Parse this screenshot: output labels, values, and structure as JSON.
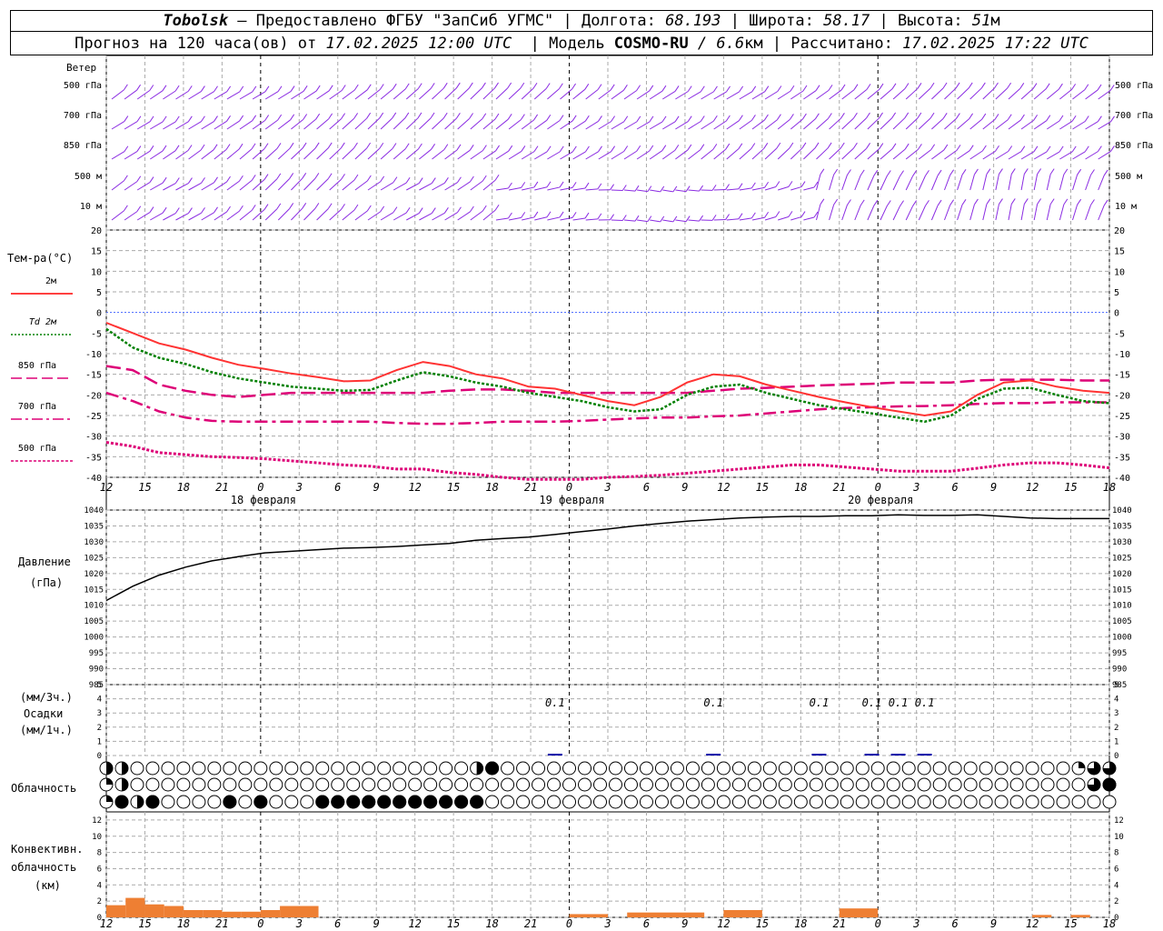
{
  "header": {
    "station": "Tobolsk",
    "provider": " — Предоставлено ФГБУ \"ЗапСиб УГМС\" | Долгота: ",
    "lon": "68.193",
    "lat_label": " | Широта: ",
    "lat": "58.17",
    "alt_label": " | Высота: ",
    "alt": "51",
    "alt_unit": "м",
    "forecast_label": "Прогноз на 120 часа(ов) от ",
    "forecast_start": "17.02.2025 12:00 UTC",
    "model_label": "  | Модель ",
    "model": "COSMO-RU",
    "resolution": " / 6.6",
    "resolution_unit": "км",
    "calc_label": " | Рассчитано: ",
    "calc_time": "17.02.2025 17:22 UTC"
  },
  "time_axis": {
    "hour_labels": [
      "12",
      "15",
      "18",
      "21",
      "0",
      "3",
      "6",
      "9",
      "12",
      "15",
      "18",
      "21",
      "0",
      "3",
      "6",
      "9",
      "12",
      "15",
      "18",
      "21",
      "0",
      "3",
      "6",
      "9",
      "12",
      "15",
      "18"
    ],
    "day_labels": [
      "18 февраля",
      "19 февраля",
      "20 февраля"
    ]
  },
  "wind_panel": {
    "title": "Ветер",
    "levels": [
      "500 гПа",
      "700 гПа",
      "850 гПа",
      "500 м",
      "10  м"
    ]
  },
  "temp_panel": {
    "title": "Тем-ра(°C)",
    "legend": [
      {
        "label": "2м",
        "color": "#ff0000",
        "style": "solid"
      },
      {
        "label": "Td  2м",
        "color": "#008000",
        "style": "dotted"
      },
      {
        "label": "850 гПа",
        "color": "#dd0077",
        "style": "dash"
      },
      {
        "label": "700 гПа",
        "color": "#dd0077",
        "style": "dashdot"
      },
      {
        "label": "500 гПа",
        "color": "#dd0077",
        "style": "dot"
      }
    ],
    "ticks": [
      "20",
      "15",
      "10",
      "5",
      "0",
      "-5",
      "-10",
      "-15",
      "-20",
      "-25",
      "-30",
      "-35",
      "-40"
    ]
  },
  "pressure_panel": {
    "title": "Давление",
    "unit": "(гПа)",
    "ticks": [
      "1040",
      "1035",
      "1030",
      "1025",
      "1020",
      "1015",
      "1010",
      "1005",
      "1000",
      "995",
      "990",
      "985"
    ]
  },
  "precip_panel": {
    "unit1": "(мм/3ч.)",
    "title": "Осадки",
    "unit2": "(мм/1ч.)",
    "ticks": [
      "5",
      "4",
      "3",
      "2",
      "1",
      "0"
    ],
    "labels": [
      "0.1",
      "0.1",
      "0.1",
      "0.1",
      "0.1",
      "0.1"
    ]
  },
  "cloud_panel": {
    "title": "Облачность"
  },
  "conv_panel": {
    "title1": "Конвективн.",
    "title2": "облачность",
    "unit": "(км)",
    "ticks": [
      "12",
      "10",
      "8",
      "6",
      "4",
      "2",
      "0"
    ]
  },
  "chart_data": {
    "type": "line",
    "x_hours": [
      0,
      3,
      6,
      9,
      12,
      15,
      18,
      21,
      24,
      27,
      30,
      33,
      36,
      39,
      42,
      45,
      48,
      51,
      54,
      57,
      60,
      63,
      66,
      69,
      72,
      75,
      78
    ],
    "series": [
      {
        "name": "2м",
        "values": [
          -2.5,
          -5,
          -7.5,
          -9,
          -11,
          -12.7,
          -13.7,
          -14.8,
          -15.7,
          -16.7,
          -16.5,
          -14,
          -12,
          -13,
          -15,
          -16,
          -18,
          -18.5,
          -20,
          -21.5,
          -22.5,
          -20.5,
          -17,
          -15,
          -15.5,
          -17.5,
          -19,
          -20.5,
          -21.8,
          -23,
          -24,
          -25,
          -24,
          -20,
          -17,
          -16.5,
          -18,
          -19,
          -19.5
        ]
      },
      {
        "name": "Td  2м",
        "values": [
          -4,
          -8.5,
          -11,
          -12.5,
          -14.5,
          -16,
          -17,
          -18,
          -18.5,
          -19,
          -18.8,
          -16.5,
          -14.5,
          -15.5,
          -17,
          -18,
          -19.5,
          -20.5,
          -21.5,
          -23,
          -24,
          -23.5,
          -20,
          -18,
          -17.5,
          -19.5,
          -21,
          -22.5,
          -23.5,
          -24.5,
          -25.5,
          -26.5,
          -25,
          -21,
          -18.5,
          -18.3,
          -20,
          -21.5,
          -22
        ]
      },
      {
        "name": "850 гПа",
        "values": [
          -13,
          -14,
          -17.5,
          -19,
          -20,
          -20.5,
          -20,
          -19.5,
          -19.5,
          -19.5,
          -19.5,
          -19.5,
          -19.5,
          -19,
          -18.7,
          -18.7,
          -19,
          -19.5,
          -19.5,
          -19.5,
          -19.5,
          -19.5,
          -19.5,
          -19,
          -18.5,
          -18.3,
          -18,
          -17.7,
          -17.5,
          -17.3,
          -17,
          -17,
          -17,
          -16.5,
          -16.3,
          -16.3,
          -16.3,
          -16.5,
          -16.5
        ]
      },
      {
        "name": "700 гПа",
        "values": [
          -19.5,
          -21.5,
          -24,
          -25.5,
          -26.3,
          -26.5,
          -26.5,
          -26.5,
          -26.5,
          -26.5,
          -26.5,
          -26.8,
          -27,
          -27,
          -26.8,
          -26.5,
          -26.5,
          -26.5,
          -26.3,
          -26,
          -25.7,
          -25.5,
          -25.5,
          -25.2,
          -25,
          -24.5,
          -24,
          -23.5,
          -23.2,
          -23,
          -22.8,
          -22.7,
          -22.5,
          -22.2,
          -22,
          -22,
          -21.8,
          -21.8,
          -21.8
        ]
      },
      {
        "name": "500 гПа",
        "values": [
          -31.5,
          -32.5,
          -34,
          -34.5,
          -35,
          -35.2,
          -35.5,
          -36,
          -36.5,
          -37,
          -37.3,
          -38,
          -38,
          -38.8,
          -39.3,
          -40,
          -40.5,
          -40.5,
          -40.5,
          -40,
          -39.8,
          -39.5,
          -39,
          -38.5,
          -38,
          -37.5,
          -37,
          -37,
          -37.5,
          -38,
          -38.5,
          -38.5,
          -38.5,
          -37.8,
          -37,
          -36.5,
          -36.5,
          -37,
          -37.7
        ]
      },
      {
        "name": "Давление",
        "values": [
          1011.5,
          1016,
          1019.5,
          1022,
          1024,
          1025.3,
          1026.5,
          1027,
          1027.5,
          1028,
          1028.2,
          1028.5,
          1029,
          1029.5,
          1030.5,
          1031,
          1031.5,
          1032.3,
          1033.2,
          1034,
          1035,
          1035.8,
          1036.5,
          1037,
          1037.5,
          1037.8,
          1038,
          1038,
          1038.2,
          1038.2,
          1038.5,
          1038.3,
          1038.3,
          1038.5,
          1038,
          1037.5,
          1037.3,
          1037.3,
          1037.3
        ]
      },
      {
        "name": "Осадки",
        "values": [
          0,
          0,
          0,
          0,
          0,
          0,
          0,
          0,
          0,
          0,
          0,
          0,
          0,
          0,
          0,
          0,
          0,
          0.1,
          0,
          0,
          0,
          0,
          0,
          0.1,
          0,
          0,
          0,
          0.1,
          0,
          0.1,
          0.1,
          0.1,
          0,
          0,
          0,
          0,
          0,
          0,
          0
        ]
      }
    ],
    "convective_cloud_km": [
      {
        "from": 0,
        "to": 1,
        "top": 1.5
      },
      {
        "from": 1,
        "to": 2,
        "top": 2.4
      },
      {
        "from": 2,
        "to": 3,
        "top": 1.6
      },
      {
        "from": 3,
        "to": 4,
        "top": 1.4
      },
      {
        "from": 4,
        "to": 5,
        "top": 0.9
      },
      {
        "from": 5,
        "to": 6,
        "top": 0.9
      },
      {
        "from": 6,
        "to": 7,
        "top": 0.7
      },
      {
        "from": 7,
        "to": 8,
        "top": 0.7
      },
      {
        "from": 8,
        "to": 9,
        "top": 0.9
      },
      {
        "from": 9,
        "to": 11,
        "top": 1.4
      },
      {
        "from": 24,
        "to": 26,
        "top": 0.4
      },
      {
        "from": 27,
        "to": 31,
        "top": 0.6
      },
      {
        "from": 32,
        "to": 34,
        "top": 0.9
      },
      {
        "from": 38,
        "to": 40,
        "top": 1.1
      },
      {
        "from": 48,
        "to": 49,
        "top": 0.3
      },
      {
        "from": 50,
        "to": 51,
        "top": 0.3
      }
    ],
    "cloud_cover": {
      "upper": "23432310000000000000000000000000000000000000000000000000000000000000000000000000000000000000000000002432422200000000000000000000000000000000000000000000000000000000000000000000000000000000000000000000000000000000000000000000000000000000000000000000000000000000001303332433333",
      "middle": "1333212300000000000000000000000000000000000000000000000000000000000000000000000000000000000000000000000000000000000000000000000000000000000000000000000000000000000000000000000000000000000000000000000000000000000000000000000000000000000000000000000000000000000024334344444",
      "lower": "12344444244440000000000000000004440000044000040000200444444444444444444444444444444444444444444444444000000000000000000000000000000000000000000000000000000000000000000000000000000000000000000000000000000000000000000000000000000000000000000000000000000000000000000000000"
    },
    "ylim_temp": [
      -40,
      20
    ],
    "ylim_pressure": [
      985,
      1040
    ],
    "ylim_precip": [
      0,
      5
    ],
    "ylim_conv": [
      0,
      13
    ]
  }
}
